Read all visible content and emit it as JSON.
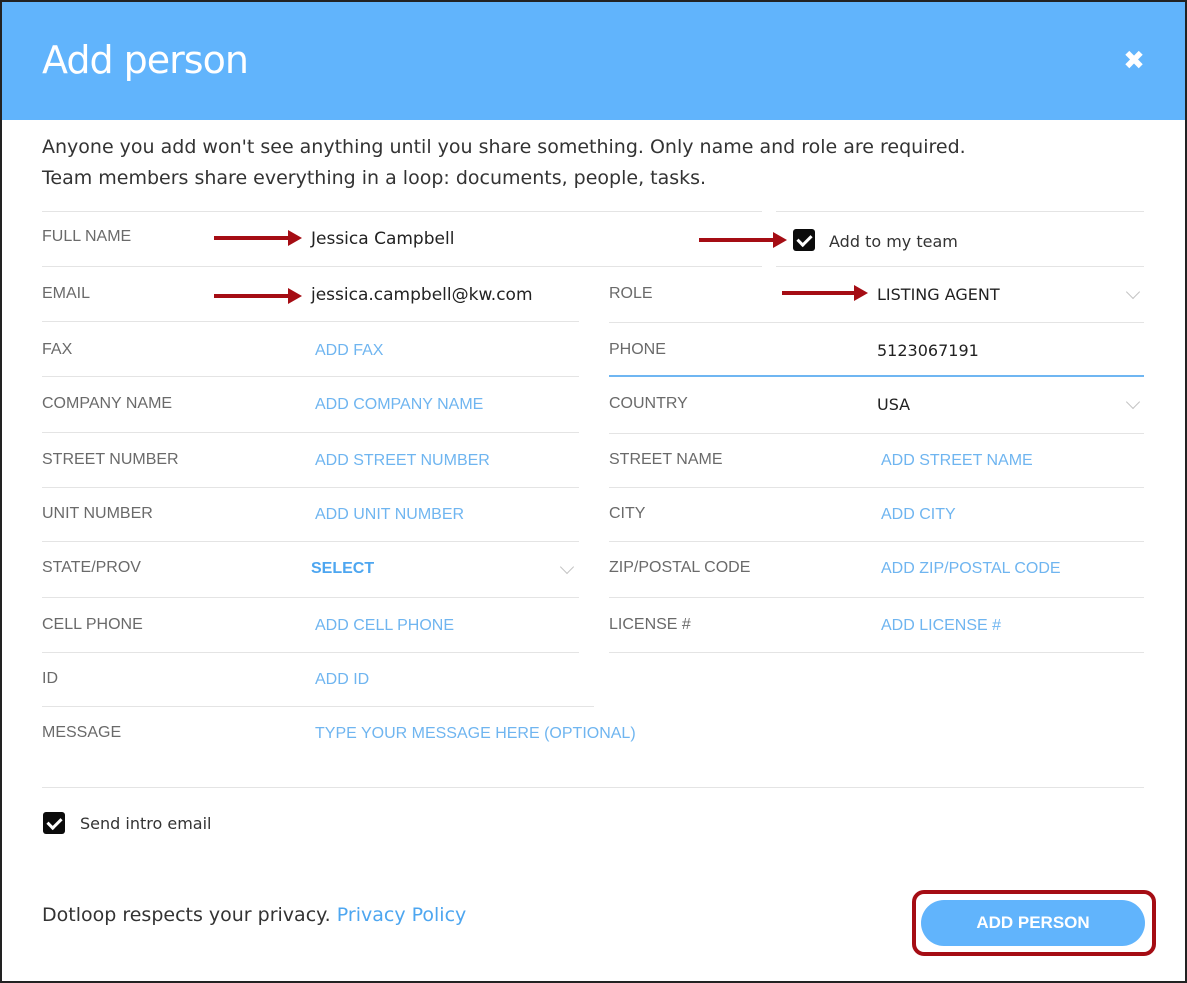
{
  "header": {
    "title": "Add person",
    "close_icon": "close-icon"
  },
  "intro": {
    "line1": "Anyone you add won't see anything until you share something. Only name and role are required.",
    "line2": "Team members share everything in a loop: documents, people, tasks."
  },
  "form": {
    "full_name": {
      "label": "FULL NAME",
      "value": "Jessica Campbell"
    },
    "add_to_team": {
      "label": "Add to my team",
      "checked": true
    },
    "email": {
      "label": "EMAIL",
      "value": "jessica.campbell@kw.com"
    },
    "role": {
      "label": "ROLE",
      "value": "LISTING AGENT"
    },
    "fax": {
      "label": "FAX",
      "placeholder": "ADD FAX"
    },
    "phone": {
      "label": "PHONE",
      "value": "5123067191"
    },
    "company_name": {
      "label": "COMPANY NAME",
      "placeholder": "ADD COMPANY NAME"
    },
    "country": {
      "label": "COUNTRY",
      "value": "USA"
    },
    "street_number": {
      "label": "STREET NUMBER",
      "placeholder": "ADD STREET NUMBER"
    },
    "street_name": {
      "label": "STREET NAME",
      "placeholder": "ADD STREET NAME"
    },
    "unit_number": {
      "label": "UNIT NUMBER",
      "placeholder": "ADD UNIT NUMBER"
    },
    "city": {
      "label": "CITY",
      "placeholder": "ADD CITY"
    },
    "state_prov": {
      "label": "STATE/PROV",
      "value": "SELECT"
    },
    "zip": {
      "label": "ZIP/POSTAL CODE",
      "placeholder": "ADD ZIP/POSTAL CODE"
    },
    "cell_phone": {
      "label": "CELL PHONE",
      "placeholder": "ADD CELL PHONE"
    },
    "license": {
      "label": "LICENSE #",
      "placeholder": "ADD LICENSE #"
    },
    "id": {
      "label": "ID",
      "placeholder": "ADD ID"
    },
    "message": {
      "label": "MESSAGE",
      "placeholder": "TYPE YOUR MESSAGE HERE (OPTIONAL)"
    }
  },
  "send_intro": {
    "label": "Send intro email",
    "checked": true
  },
  "footer": {
    "privacy_text": "Dotloop respects your privacy.",
    "privacy_link": "Privacy Policy",
    "add_button": "ADD PERSON"
  },
  "colors": {
    "header": "#61b4fc",
    "annotation": "#a50d14",
    "placeholder": "#6fb5f0"
  }
}
